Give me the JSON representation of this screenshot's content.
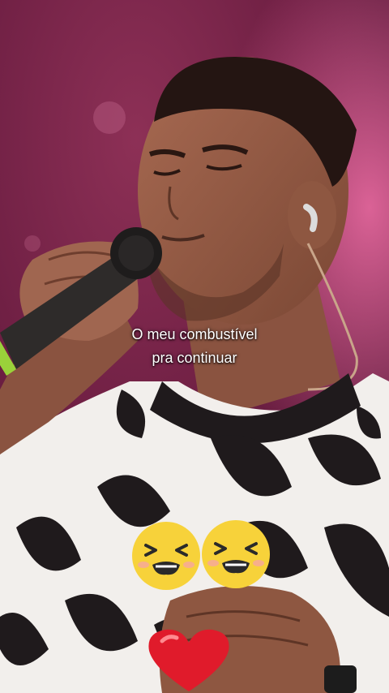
{
  "video": {
    "caption_lines": [
      "O meu combustível",
      "pra continuar"
    ]
  },
  "stickers": [
    {
      "icon": "laughing-emoji-icon"
    },
    {
      "icon": "laughing-emoji-icon"
    },
    {
      "icon": "red-heart-icon"
    }
  ],
  "colors": {
    "background": "#7a2448",
    "shirt_light": "#f2efec",
    "shirt_dark": "#1f1a1c",
    "emoji_yellow": "#f7d23a",
    "heart_red": "#e01b2b"
  }
}
